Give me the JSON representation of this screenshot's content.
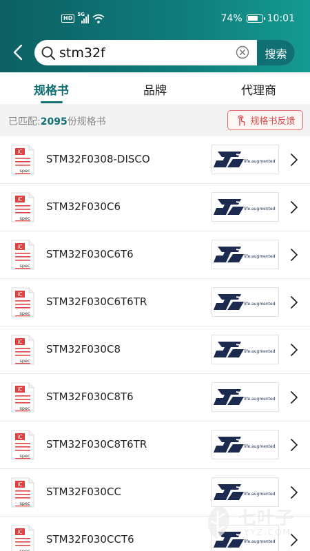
{
  "status_bar": {
    "hd_label": "HD",
    "network": "5G",
    "battery": "74%",
    "battery_level": 0.74,
    "time": "10:01"
  },
  "search": {
    "value": "stm32f",
    "button_label": "搜索"
  },
  "tabs": [
    {
      "label": "规格书",
      "active": true
    },
    {
      "label": "品牌",
      "active": false
    },
    {
      "label": "代理商",
      "active": false
    }
  ],
  "match": {
    "prefix": "已匹配:",
    "count": "2095",
    "suffix": "份规格书",
    "feedback_label": "规格书反馈"
  },
  "icons": {
    "spec_top": "iC",
    "spec_bottom": "spec",
    "brand_tagline": "life.augmented"
  },
  "parts": [
    {
      "name": "STM32F0308-DISCO"
    },
    {
      "name": "STM32F030C6"
    },
    {
      "name": "STM32F030C6T6"
    },
    {
      "name": "STM32F030C6T6TR"
    },
    {
      "name": "STM32F030C8"
    },
    {
      "name": "STM32F030C8T6"
    },
    {
      "name": "STM32F030C8T6TR"
    },
    {
      "name": "STM32F030CC"
    },
    {
      "name": "STM32F030CCT6"
    }
  ],
  "watermark": {
    "text": "七叶子",
    "sub": "YYZ.COM"
  },
  "colors": {
    "accent": "#0f6f72",
    "brand_navy": "#1b2a4e",
    "spec_red": "#e04040"
  }
}
